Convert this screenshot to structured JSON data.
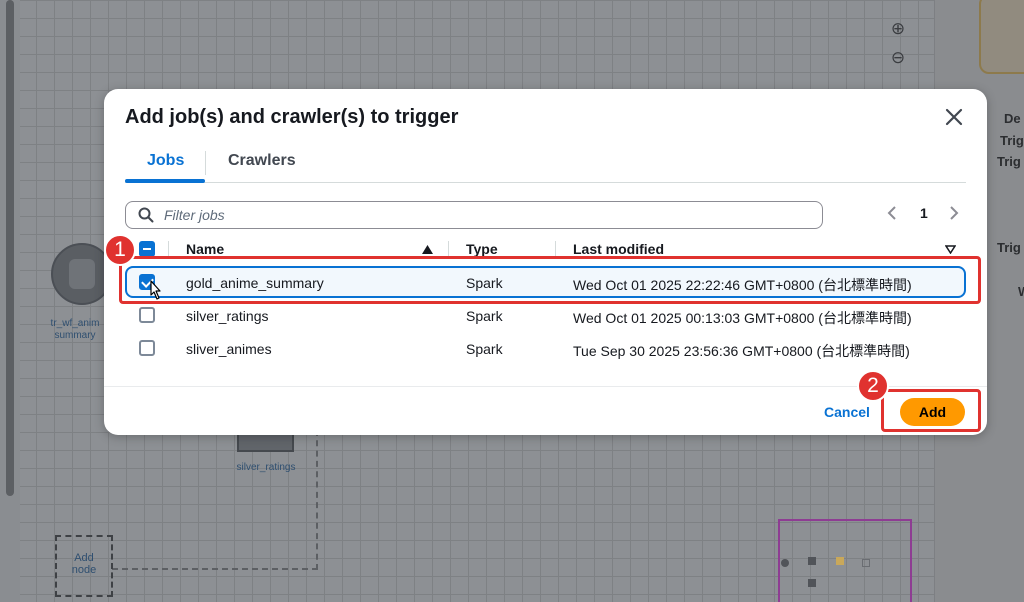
{
  "background": {
    "right_panel_texts": [
      "De",
      "Trig",
      "Trig",
      "Trig",
      "W"
    ],
    "node_label": "tr_wf_anim\nsummary",
    "square_label": "silver_ratings",
    "add_node_label": "Add\nnode"
  },
  "modal": {
    "title": "Add job(s) and crawler(s) to trigger",
    "tabs": [
      {
        "label": "Jobs",
        "active": true
      },
      {
        "label": "Crawlers",
        "active": false
      }
    ],
    "search": {
      "placeholder": "Filter jobs",
      "value": ""
    },
    "pagination": {
      "current_page": "1"
    },
    "table": {
      "columns": [
        "Name",
        "Type",
        "Last modified"
      ],
      "sort_column": "Name",
      "rows": [
        {
          "name": "gold_anime_summary",
          "type": "Spark",
          "last_modified": "Wed Oct 01 2025 22:22:46 GMT+0800 (台北標準時間)",
          "selected": true
        },
        {
          "name": "silver_ratings",
          "type": "Spark",
          "last_modified": "Wed Oct 01 2025 00:13:03 GMT+0800 (台北標準時間)",
          "selected": false
        },
        {
          "name": "sliver_animes",
          "type": "Spark",
          "last_modified": "Tue Sep 30 2025 23:56:36 GMT+0800 (台北標準時間)",
          "selected": false
        }
      ]
    },
    "footer": {
      "cancel_label": "Cancel",
      "add_label": "Add"
    }
  },
  "annotations": {
    "badge_1": "1",
    "badge_2": "2"
  },
  "colors": {
    "accent": "#0972d3",
    "primary_button": "#ff9900",
    "annotation": "#e0322f"
  }
}
